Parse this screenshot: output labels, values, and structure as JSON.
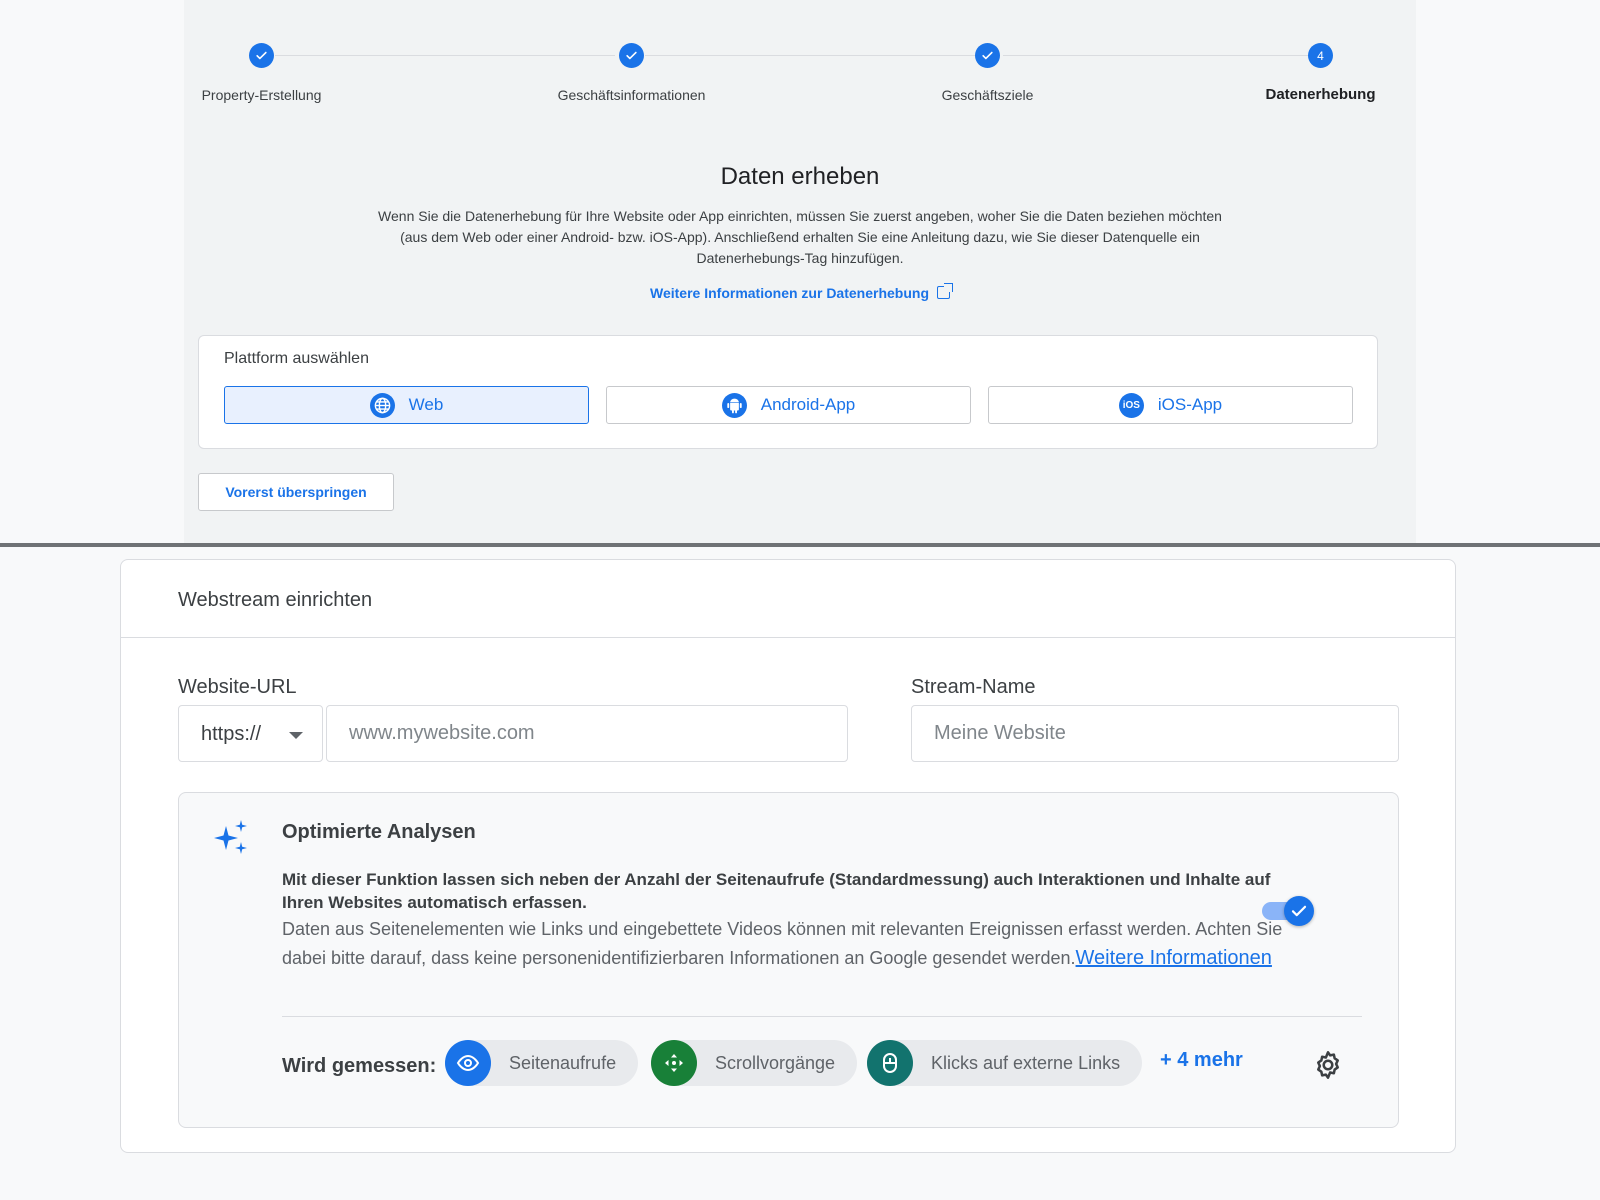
{
  "stepper": {
    "steps": [
      {
        "label": "Property-Erstellung",
        "state": "done"
      },
      {
        "label": "Geschäftsinformationen",
        "state": "done"
      },
      {
        "label": "Geschäftsziele",
        "state": "done"
      },
      {
        "label": "Datenerhebung",
        "state": "active",
        "number": "4"
      }
    ]
  },
  "collect": {
    "title": "Daten erheben",
    "description": "Wenn Sie die Datenerhebung für Ihre Website oder App einrichten, müssen Sie zuerst angeben, woher Sie die Daten beziehen möchten (aus dem Web oder einer Android- bzw. iOS-App). Anschließend erhalten Sie eine Anleitung dazu, wie Sie dieser Datenquelle ein Datenerhebungs-Tag hinzufügen.",
    "more_link": "Weitere Informationen zur Datenerhebung"
  },
  "platform": {
    "label": "Plattform auswählen",
    "options": [
      {
        "label": "Web",
        "icon": "globe-icon",
        "selected": true
      },
      {
        "label": "Android-App",
        "icon": "android-icon",
        "selected": false
      },
      {
        "label": "iOS-App",
        "icon": "ios-icon",
        "icon_text": "iOS",
        "selected": false
      }
    ]
  },
  "skip_label": "Vorerst überspringen",
  "webstream": {
    "title": "Webstream einrichten",
    "url_label": "Website-URL",
    "protocol": "https://",
    "url_placeholder": "www.mywebsite.com",
    "stream_label": "Stream-Name",
    "stream_placeholder": "Meine Website"
  },
  "enhanced": {
    "title": "Optimierte Analysen",
    "bold_text": "Mit dieser Funktion lassen sich neben der Anzahl der Seitenaufrufe (Standardmessung) auch Interaktionen und Inhalte auf Ihren Websites automatisch erfassen.",
    "text": "Daten aus Seitenelementen wie Links und eingebettete Videos können mit relevanten Ereignissen erfasst werden. Achten Sie dabei bitte darauf, dass keine personenidentifizierbaren Informationen an Google gesendet werden.",
    "link": "Weitere Informationen",
    "toggle_on": true,
    "measured_label": "Wird gemessen:",
    "chips": [
      {
        "label": "Seitenaufrufe",
        "icon": "eye-icon",
        "color": "#1a73e8"
      },
      {
        "label": "Scrollvorgänge",
        "icon": "scroll-icon",
        "color": "#188038"
      },
      {
        "label": "Klicks auf externe Links",
        "icon": "mouse-icon",
        "color": "#12736e"
      }
    ],
    "more": "+ 4 mehr"
  },
  "colors": {
    "accent": "#1a73e8",
    "text": "#3c4043"
  }
}
